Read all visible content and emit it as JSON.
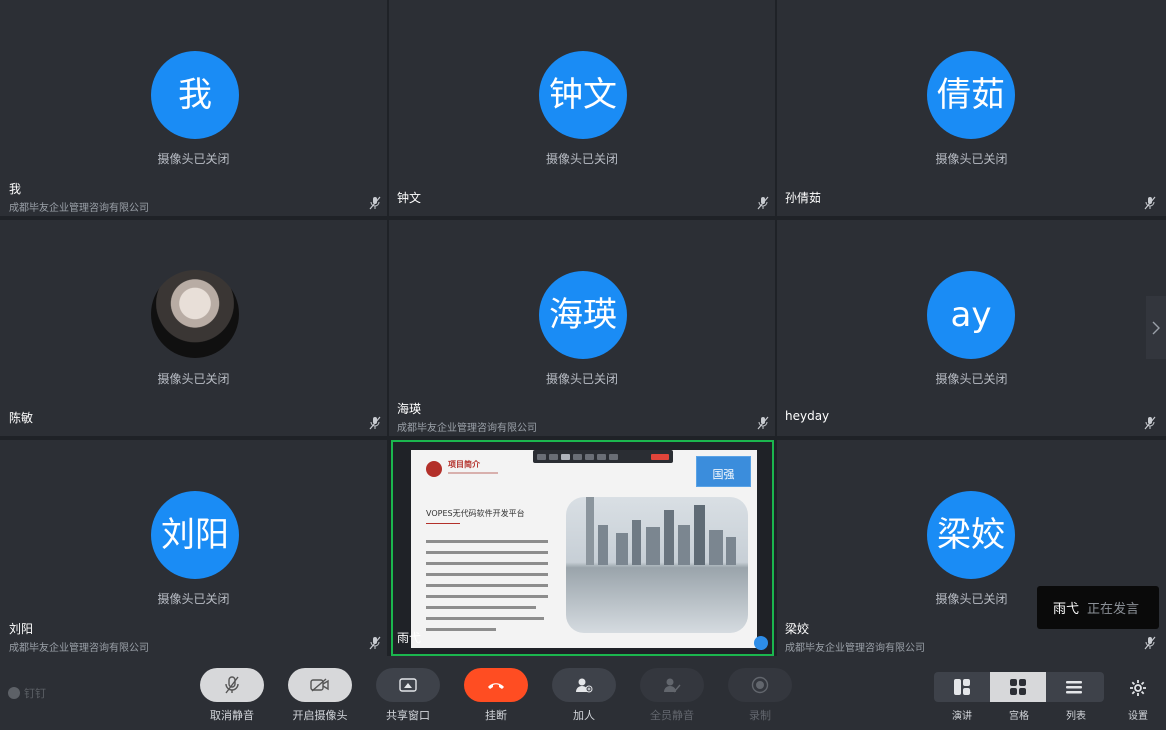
{
  "grid": {
    "cam_off_text": "摄像头已关闭",
    "tiles": [
      {
        "avatar_text": "我",
        "name": "我",
        "org": "成都毕友企业管理咨询有限公司"
      },
      {
        "avatar_text": "钟文",
        "name": "钟文",
        "org": ""
      },
      {
        "avatar_text": "倩茹",
        "name": "孙倩茹",
        "org": ""
      },
      {
        "avatar_text": "",
        "name": "陈敏",
        "org": ""
      },
      {
        "avatar_text": "海瑛",
        "name": "海瑛",
        "org": "成都毕友企业管理咨询有限公司"
      },
      {
        "avatar_text": "ay",
        "name": "heyday",
        "org": ""
      },
      {
        "avatar_text": "刘阳",
        "name": "刘阳",
        "org": "成都毕友企业管理咨询有限公司"
      },
      {
        "avatar_text": "梁姣",
        "name": "梁姣",
        "org": "成都毕友企业管理咨询有限公司"
      }
    ]
  },
  "share": {
    "presenter_name": "雨弋",
    "pip_name": "国强",
    "slide": {
      "title": "项目简介",
      "heading": "VOPES无代码软件开发平台"
    }
  },
  "speaking": {
    "name": "雨弋",
    "status": "正在发言"
  },
  "bottom": {
    "brand": "钉钉",
    "controls": [
      {
        "label": "取消静音"
      },
      {
        "label": "开启摄像头"
      },
      {
        "label": "共享窗口"
      },
      {
        "label": "挂断"
      },
      {
        "label": "加人"
      },
      {
        "label": "全员静音"
      },
      {
        "label": "录制"
      }
    ],
    "layouts": [
      {
        "label": "演讲"
      },
      {
        "label": "宫格"
      },
      {
        "label": "列表"
      }
    ],
    "settings_label": "设置"
  },
  "colors": {
    "avatar": "#1a8cf5",
    "hangup": "#ff4d22",
    "share_border": "#1bb64e"
  }
}
